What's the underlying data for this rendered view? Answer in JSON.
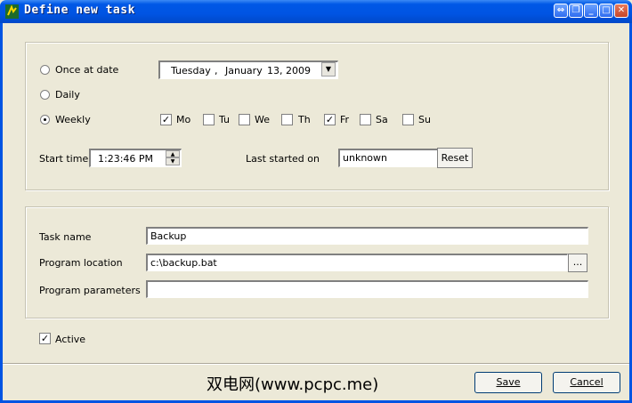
{
  "window": {
    "title": "Define new task",
    "controls": [
      "pin-icon",
      "restore-icon",
      "minimize-icon",
      "maximize-icon",
      "close-icon"
    ]
  },
  "schedule": {
    "once_label": "Once at date",
    "date_day": "Tuesday",
    "date_sep": ",",
    "date_month": "January",
    "date_daynum_year": "13, 2009",
    "daily_label": "Daily",
    "weekly_label": "Weekly",
    "selected_mode": "weekly",
    "days": [
      {
        "label": "Mo",
        "checked": true
      },
      {
        "label": "Tu",
        "checked": false
      },
      {
        "label": "We",
        "checked": false
      },
      {
        "label": "Th",
        "checked": false
      },
      {
        "label": "Fr",
        "checked": true
      },
      {
        "label": "Sa",
        "checked": false
      },
      {
        "label": "Su",
        "checked": false
      }
    ],
    "start_time_label": "Start time",
    "start_time_value": "1:23:46 PM",
    "last_started_label": "Last started on",
    "last_started_value": "unknown",
    "reset_label": "Reset"
  },
  "task": {
    "name_label": "Task name",
    "name_value": "Backup",
    "location_label": "Program location",
    "location_value": "c:\\backup.bat",
    "browse_label": "...",
    "params_label": "Program parameters",
    "params_value": ""
  },
  "active": {
    "label": "Active",
    "checked": true
  },
  "footer": {
    "watermark": "双电网(www.pcpc.me)",
    "save_label": "Save",
    "cancel_label": "Cancel"
  }
}
